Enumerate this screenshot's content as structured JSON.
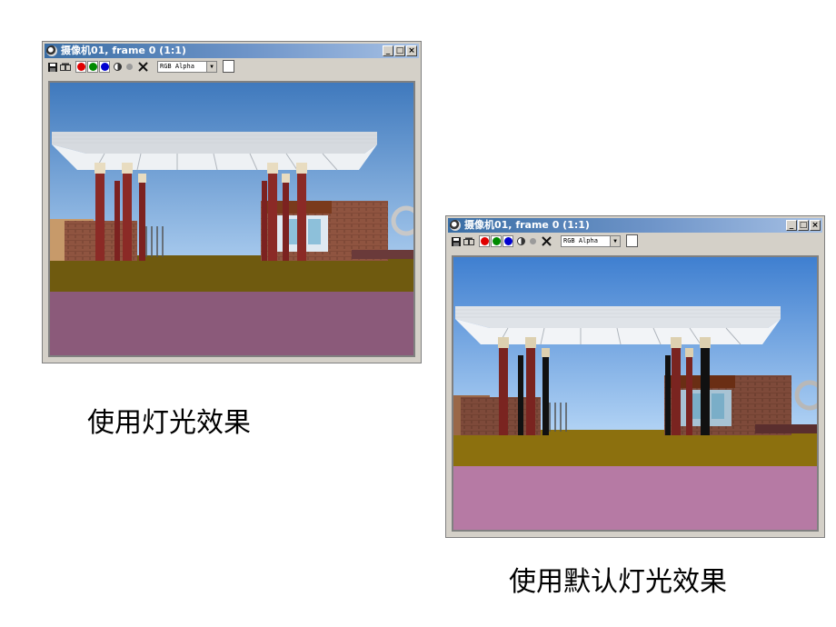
{
  "windows": [
    {
      "title": "摄像机01, frame 0 (1:1)",
      "title_buttons": [
        "_",
        "□",
        "×"
      ],
      "channel_select": "RGB Alpha",
      "caption": "使用灯光效果"
    },
    {
      "title": "摄像机01, frame 0 (1:1)",
      "title_buttons": [
        "_",
        "□",
        "×"
      ],
      "channel_select": "RGB Alpha",
      "caption": "使用默认灯光效果"
    }
  ],
  "toolbar_icons": [
    "save-icon",
    "copy-icon",
    "red-channel-icon",
    "green-channel-icon",
    "blue-channel-icon",
    "mono-icon",
    "gray-dot-icon",
    "clear-icon"
  ],
  "colors": {
    "title_start": "#3a6ea5",
    "title_end": "#a6c0e4",
    "red": "#e00000",
    "green": "#008a00",
    "blue": "#0000d0"
  }
}
